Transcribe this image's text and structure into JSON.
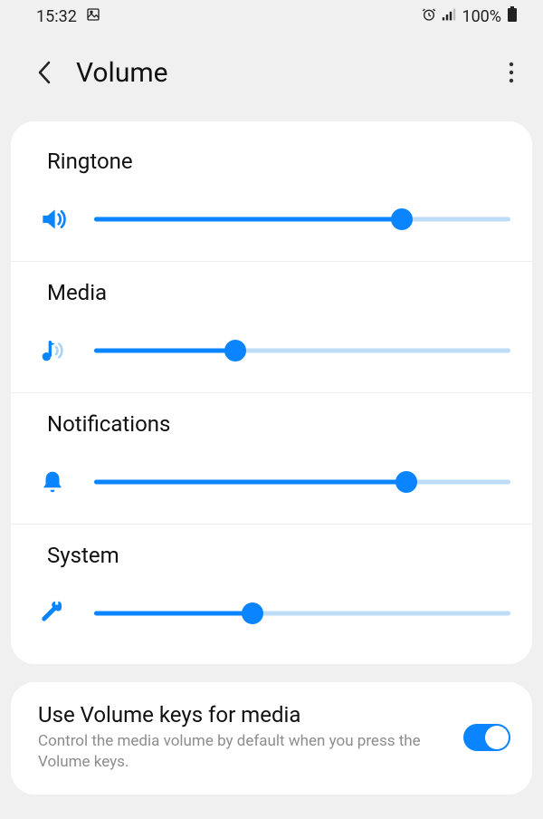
{
  "status": {
    "time": "15:32",
    "battery": "100%"
  },
  "header": {
    "title": "Volume"
  },
  "accent": "#0a84ff",
  "sliders": {
    "ringtone": {
      "label": "Ringtone",
      "value": 74
    },
    "media": {
      "label": "Media",
      "value": 34
    },
    "notifications": {
      "label": "Notifications",
      "value": 75
    },
    "system": {
      "label": "System",
      "value": 38
    }
  },
  "option": {
    "title": "Use Volume keys for media",
    "desc": "Control the media volume by default when you press the Volume keys.",
    "enabled": true
  }
}
